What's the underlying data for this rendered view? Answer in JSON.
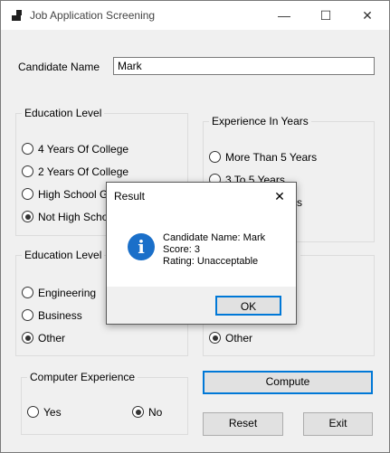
{
  "window": {
    "title": "Job Application Screening",
    "minimize": "—",
    "maximize": "☐",
    "close": "✕"
  },
  "candidate": {
    "label": "Candidate Name",
    "value": "Mark"
  },
  "education_level": {
    "title": "Education Level",
    "options": [
      {
        "label": "4 Years Of College",
        "checked": false
      },
      {
        "label": "2 Years Of College",
        "checked": false
      },
      {
        "label": "High School Gr",
        "checked": false
      },
      {
        "label": "Not High Scho",
        "checked": true
      }
    ]
  },
  "experience": {
    "title": "Experience In Years",
    "options": [
      {
        "label": "More Than 5 Years",
        "checked": false
      },
      {
        "label": "3 To 5 Years",
        "checked": false
      },
      {
        "label": "rs",
        "checked": false
      }
    ]
  },
  "education_field": {
    "title": "Education Level",
    "options": [
      {
        "label": "Engineering",
        "checked": false
      },
      {
        "label": "Business",
        "checked": false
      },
      {
        "label": "Other",
        "checked": true
      }
    ]
  },
  "right_field": {
    "title_fragment": "d",
    "options": [
      {
        "label": "Other",
        "checked": true
      }
    ]
  },
  "computer_experience": {
    "title": "Computer Experience",
    "options": [
      {
        "label": "Yes",
        "checked": false
      },
      {
        "label": "No",
        "checked": true
      }
    ]
  },
  "buttons": {
    "compute": "Compute",
    "reset": "Reset",
    "exit": "Exit"
  },
  "dialog": {
    "title": "Result",
    "close": "✕",
    "icon": "info-icon",
    "lines": [
      "Candidate Name: Mark",
      "Score: 3",
      "Rating: Unacceptable"
    ],
    "ok": "OK"
  }
}
